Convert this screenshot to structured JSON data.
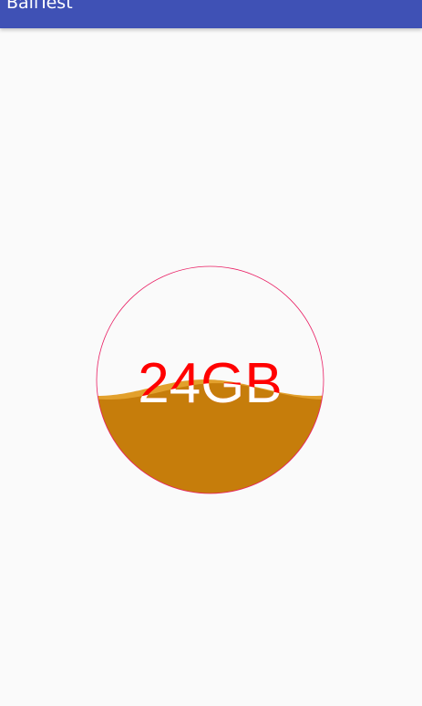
{
  "app": {
    "title": "BallTest"
  },
  "ball": {
    "value_text": "24GB",
    "fill_level": 0.45,
    "colors": {
      "outline": "#e91e63",
      "liquid": "#c67d0b",
      "liquid_edge": "#e2a02c",
      "text_above": "#ff0000",
      "text_in_liquid": "#ffffff"
    }
  }
}
